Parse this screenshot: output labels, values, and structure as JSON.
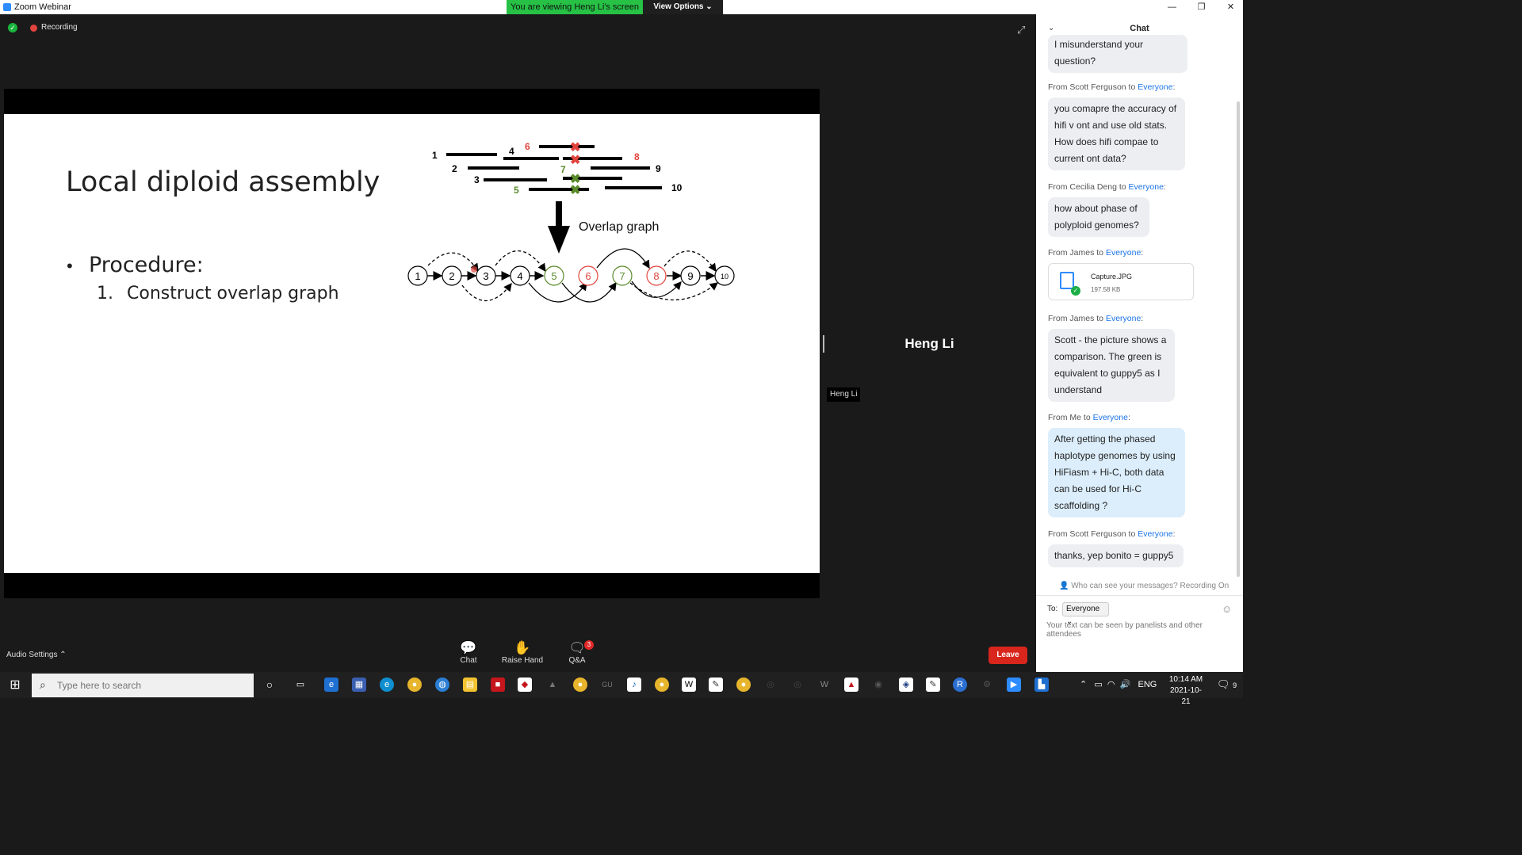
{
  "window": {
    "title": "Zoom Webinar",
    "viewing_banner": "You are viewing Heng Li's screen",
    "view_options": "View Options",
    "controls": [
      "—",
      "❐",
      "✕"
    ]
  },
  "recording": {
    "label": "Recording"
  },
  "slide": {
    "title": "Local diploid assembly",
    "bullet": "Procedure:",
    "step_number": "1.",
    "step": "Construct overlap graph",
    "diagram": {
      "arrow_label": "Overlap graph",
      "read_labels": [
        "1",
        "2",
        "3",
        "4",
        "5",
        "6",
        "7",
        "8",
        "9",
        "10"
      ],
      "nodes": [
        "1",
        "2",
        "3",
        "4",
        "5",
        "6",
        "7",
        "8",
        "9",
        "10"
      ]
    }
  },
  "speaker": {
    "name": "Heng Li",
    "tag": "Heng Li"
  },
  "toolbar": {
    "audio_settings": "Audio Settings",
    "chat": "Chat",
    "raise_hand": "Raise Hand",
    "qa": "Q&A",
    "qa_badge": "3",
    "leave": "Leave"
  },
  "chat": {
    "header": "Chat",
    "top_fragment": "I misunderstand your question?",
    "messages": [
      {
        "from": "From Scott Ferguson to ",
        "to": "Everyone",
        "text": "you comapre the accuracy of hifi v ont and use old stats. How does hifi compae to current ont data?"
      },
      {
        "from": "From Cecilia Deng to ",
        "to": "Everyone",
        "text": "how about phase of polyploid genomes?"
      },
      {
        "from": "From James to ",
        "to": "Everyone",
        "file_name": "Capture.JPG",
        "file_size": "197.58 KB"
      },
      {
        "from": "From James to ",
        "to": "Everyone",
        "text": "Scott - the picture shows a comparison. The green is equivalent to guppy5 as I understand"
      },
      {
        "from": "From Me to ",
        "to": "Everyone",
        "text": "After getting the phased haplotype genomes by using HiFiasm + Hi-C, both data can be used for Hi-C scaffolding ?"
      },
      {
        "from": "From Scott Ferguson to ",
        "to": "Everyone",
        "text": "thanks, yep bonito = guppy5"
      }
    ],
    "privacy_note": "Who can see your messages? Recording On",
    "to_label": "To:",
    "to_value": "Everyone",
    "input_placeholder": "Your text can be seen by panelists and other attendees"
  },
  "taskbar": {
    "search_placeholder": "Type here to search",
    "language": "ENG",
    "time": "10:14 AM",
    "date": "2021-10-21",
    "notification_count": "9"
  },
  "colors": {
    "accent": "#2D8CFF",
    "banner_green": "#26c145",
    "leave_red": "#d8261c",
    "diagram_red": "#e0443c",
    "diagram_green": "#5a8a2a",
    "link_blue": "#1a73e8"
  }
}
